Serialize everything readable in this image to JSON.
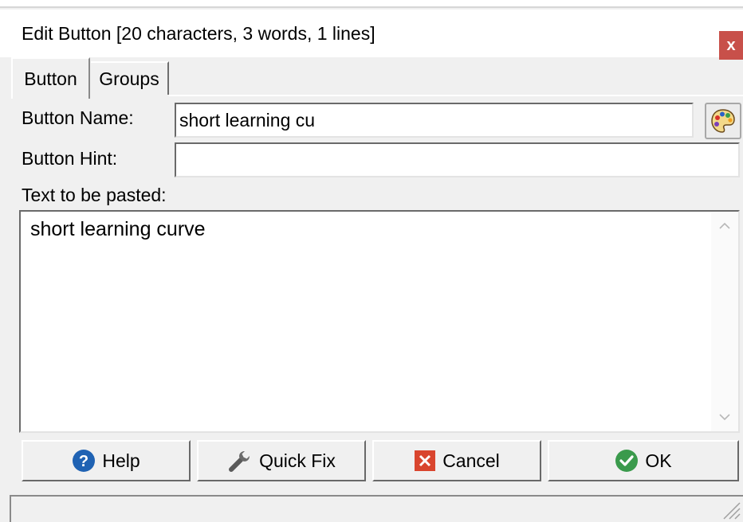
{
  "window": {
    "title": "Edit Button [20 characters, 3 words, 1 lines]",
    "close_label": "x",
    "close_color": "#c8504a"
  },
  "tabs": [
    {
      "label": "Button",
      "active": true
    },
    {
      "label": "Groups",
      "active": false
    }
  ],
  "form": {
    "name_label": "Button Name:",
    "name_value": "short learning cu",
    "hint_label": "Button Hint:",
    "hint_value": "",
    "paste_label": "Text to be pasted:",
    "paste_value": "short learning curve"
  },
  "buttons": {
    "help": "Help",
    "quick_fix": "Quick Fix",
    "cancel": "Cancel",
    "ok": "OK"
  },
  "icons": {
    "palette": "palette-icon",
    "help": "question-circle-icon",
    "quick_fix": "wrench-icon",
    "cancel": "red-x-square-icon",
    "ok": "green-check-circle-icon"
  },
  "colors": {
    "help_icon": "#1f62b3",
    "cancel_icon": "#d9452e",
    "ok_icon": "#3a9a4c"
  }
}
